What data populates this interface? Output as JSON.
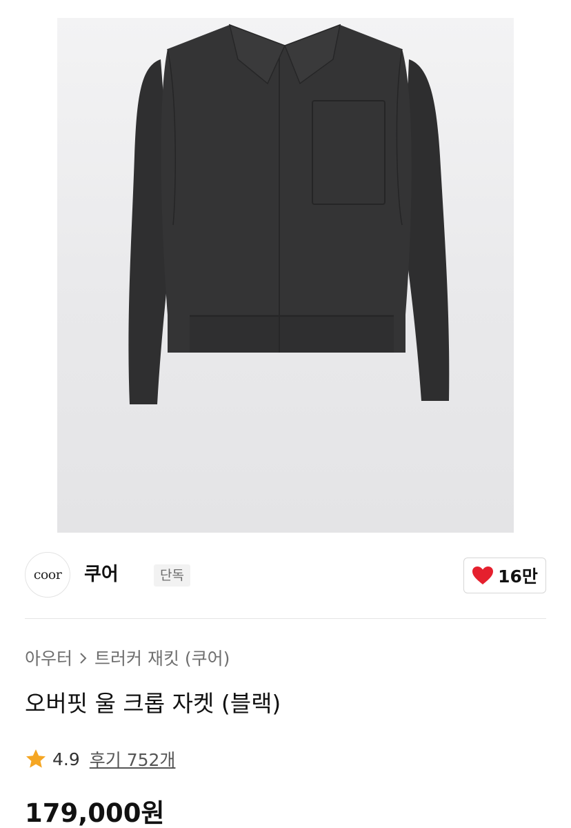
{
  "brand": {
    "logo_text": "coor",
    "name": "쿠어",
    "badge": "단독"
  },
  "like": {
    "count": "16만",
    "icon": "heart-icon",
    "color": "#e5202e"
  },
  "breadcrumb": {
    "category": "아우터",
    "subcategory": "트러커 재킷 (쿠어)",
    "separator_icon": "chevron-right-icon"
  },
  "product": {
    "title": "오버핏 울 크롭 자켓 (블랙)",
    "rating": "4.9",
    "review_label": "후기 752개",
    "price": "179,000원",
    "star_color": "#f5a623"
  }
}
